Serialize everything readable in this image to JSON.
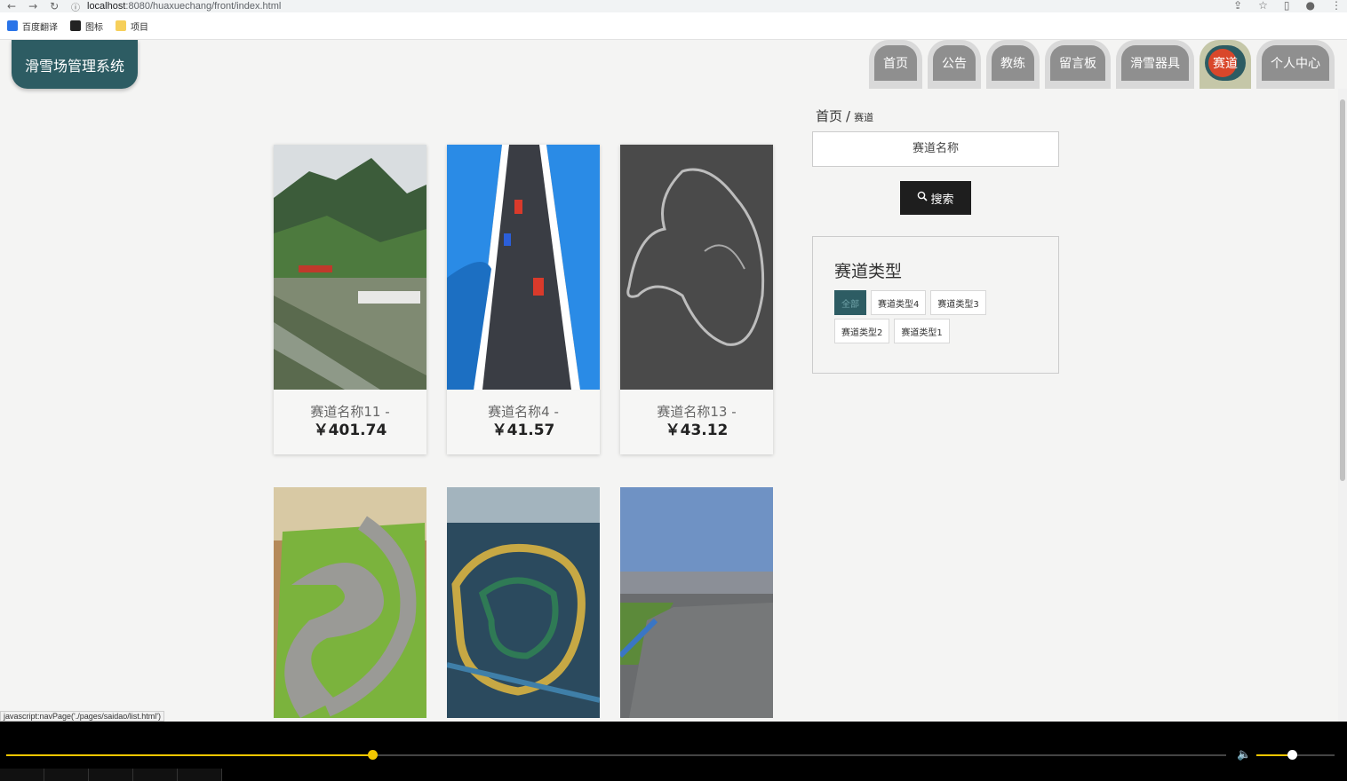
{
  "browser": {
    "url_host": "localhost",
    "url_rest": ":8080/huaxuechang/front/index.html",
    "bookmarks": [
      {
        "label": "百度翻译",
        "color": "#2a74e8"
      },
      {
        "label": "图标",
        "color": "#222222"
      },
      {
        "label": "项目",
        "color": "#f6cf5a"
      }
    ]
  },
  "header": {
    "logo_text": "滑雪场管理系统",
    "nav": [
      {
        "label": "首页"
      },
      {
        "label": "公告"
      },
      {
        "label": "教练"
      },
      {
        "label": "留言板"
      },
      {
        "label": "滑雪器具"
      },
      {
        "label": "赛道",
        "active": true
      },
      {
        "label": "个人中心"
      }
    ]
  },
  "breadcrumb": {
    "home": "首页",
    "separator": "/",
    "current": "赛道"
  },
  "search": {
    "placeholder": "赛道名称",
    "button_label": "搜索"
  },
  "types": {
    "title": "赛道类型",
    "tags": [
      {
        "label": "全部",
        "active": true
      },
      {
        "label": "赛道类型4"
      },
      {
        "label": "赛道类型3"
      },
      {
        "label": "赛道类型2"
      },
      {
        "label": "赛道类型1"
      }
    ]
  },
  "cards": [
    {
      "name": "赛道名称11",
      "suffix": " -",
      "price": "￥401.74"
    },
    {
      "name": "赛道名称4",
      "suffix": " -",
      "price": "￥41.57"
    },
    {
      "name": "赛道名称13",
      "suffix": " -",
      "price": "￥43.12"
    }
  ],
  "status_bar_text": "javascript:navPage('./pages/saidao/list.html')",
  "player": {
    "progress": 0.3,
    "volume": 0.45
  }
}
